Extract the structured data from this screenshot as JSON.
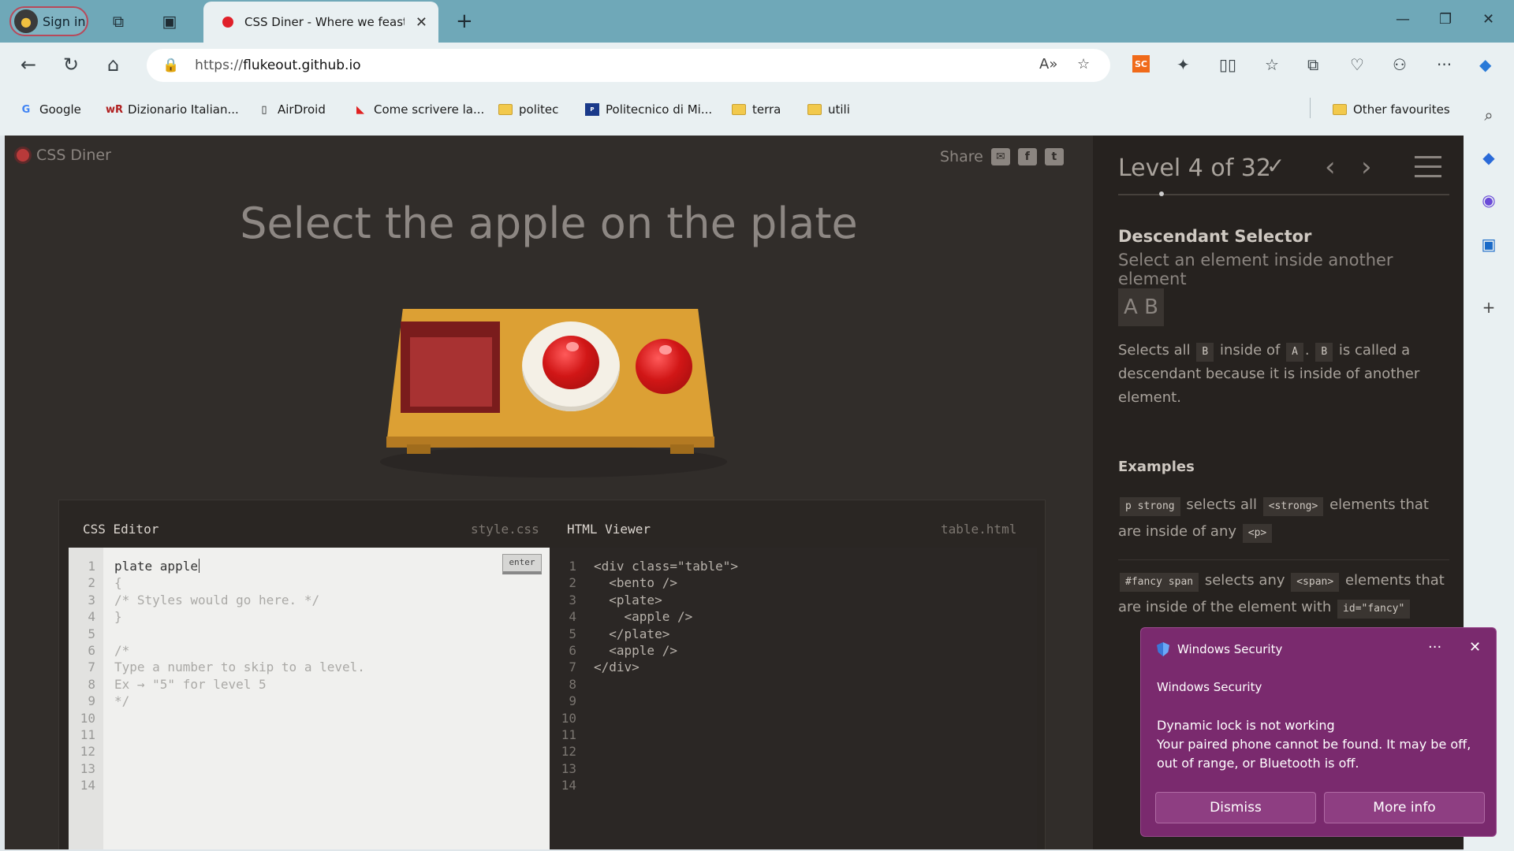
{
  "browser": {
    "signin_label": "Sign in",
    "tab_title": "CSS Diner - Where we feast",
    "url_prefix": "https://",
    "url_host": "flukeout.github.io",
    "ext_badge": "SC"
  },
  "bookmarks": [
    {
      "label": "Google",
      "icon": "G"
    },
    {
      "label": "Dizionario Italian...",
      "icon": "wR"
    },
    {
      "label": "AirDroid",
      "icon": "doc"
    },
    {
      "label": "Come scrivere la...",
      "icon": "K"
    },
    {
      "label": "politec",
      "icon": "folder"
    },
    {
      "label": "Politecnico di Mi...",
      "icon": "polimi"
    },
    {
      "label": "terra",
      "icon": "folder"
    },
    {
      "label": "utili",
      "icon": "folder"
    }
  ],
  "bookmarks_other": "Other favourites",
  "site": {
    "brand": "CSS Diner",
    "share_label": "Share",
    "instruction": "Select the apple on the plate"
  },
  "css_editor": {
    "title": "CSS Editor",
    "file": "style.css",
    "input": "plate apple",
    "enter_label": "enter",
    "lines": [
      "",
      "{",
      "/* Styles would go here. */",
      "}",
      "",
      "/*",
      "Type a number to skip to a level.",
      "Ex → \"5\" for level 5",
      "*/",
      "",
      "",
      "",
      "",
      ""
    ],
    "line_numbers": [
      "1",
      "2",
      "3",
      "4",
      "5",
      "6",
      "7",
      "8",
      "9",
      "10",
      "11",
      "12",
      "13",
      "14"
    ]
  },
  "html_viewer": {
    "title": "HTML Viewer",
    "file": "table.html",
    "lines": [
      "<div class=\"table\">",
      "  <bento />",
      "  <plate>",
      "    <apple />",
      "  </plate>",
      "  <apple />",
      "</div>",
      "",
      "",
      "",
      "",
      "",
      "",
      ""
    ],
    "line_numbers": [
      "1",
      "2",
      "3",
      "4",
      "5",
      "6",
      "7",
      "8",
      "9",
      "10",
      "11",
      "12",
      "13",
      "14"
    ]
  },
  "level": {
    "title": "Level 4 of 32",
    "check": "✓",
    "selector_name": "Descendant Selector",
    "selector_title": "Select an element inside another element",
    "syntax": "A  B",
    "hint_parts": {
      "p1": "Selects all",
      "t1": "B",
      "p2": "inside of",
      "t2": "A",
      "p3": ".",
      "t3": "B",
      "p4": "is called a descendant because it is inside of another element."
    },
    "examples_heading": "Examples",
    "example1": {
      "code": "p  strong",
      "p1": "selects all",
      "tag": "<strong>",
      "p2": "elements that are inside of any",
      "tag2": "<p>"
    },
    "example2": {
      "code": "#fancy  span",
      "p1": "selects any",
      "tag": "<span>",
      "p2": "elements that are inside of the element with",
      "tag2": "id=\"fancy\""
    }
  },
  "toast": {
    "header": "Windows Security",
    "app": "Windows Security",
    "title": "Dynamic lock is not working",
    "body": "Your paired phone cannot be found. It may be off, out of range, or Bluetooth is off.",
    "dismiss": "Dismiss",
    "more_info": "More info",
    "menu": "···",
    "close": "✕"
  },
  "colors": {
    "page_bg": "#312d2a",
    "table": "#dca034",
    "apple": "#d11616",
    "toast_bg": "#7a2a6e"
  }
}
